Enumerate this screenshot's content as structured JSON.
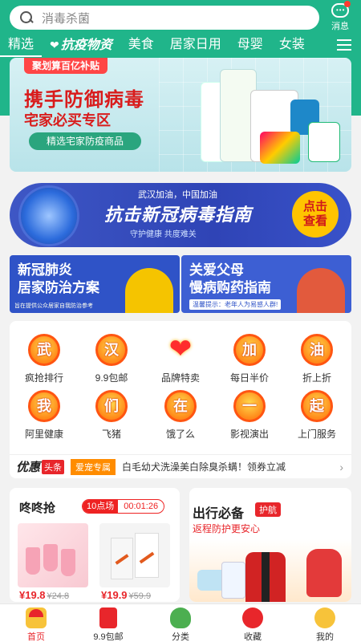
{
  "search": {
    "placeholder": "消毒杀菌"
  },
  "header": {
    "message_label": "消息"
  },
  "tabs": [
    {
      "label": "精选"
    },
    {
      "label": "抗疫物资"
    },
    {
      "label": "美食"
    },
    {
      "label": "居家日用"
    },
    {
      "label": "母婴"
    },
    {
      "label": "女装"
    }
  ],
  "hero": {
    "tag": "聚划算百亿补贴",
    "title": "携手防御病毒",
    "subtitle": "宅家必买专区",
    "button": "精选宅家防疫商品"
  },
  "guide_banner": {
    "top": "武汉加油，中国加油",
    "title": "抗击新冠病毒指南",
    "subtitle": "守护健康 共度难关",
    "button_line1": "点击",
    "button_line2": "查看"
  },
  "cards": {
    "left_title1": "新冠肺炎",
    "left_title2": "居家防治方案",
    "left_note": "旨在提供公众居家自我防治参考",
    "right_title1": "关爱父母",
    "right_title2": "慢病购药指南",
    "right_note": "温馨提示：老年人为易感人群!"
  },
  "categories": [
    {
      "glyph": "武",
      "label": "疯抢排行"
    },
    {
      "glyph": "汉",
      "label": "9.9包邮"
    },
    {
      "glyph": "❤",
      "label": "品牌特卖"
    },
    {
      "glyph": "加",
      "label": "每日半价"
    },
    {
      "glyph": "油",
      "label": "折上折"
    },
    {
      "glyph": "我",
      "label": "阿里健康"
    },
    {
      "glyph": "们",
      "label": "飞猪"
    },
    {
      "glyph": "在",
      "label": "饿了么"
    },
    {
      "glyph": "一",
      "label": "影视演出"
    },
    {
      "glyph": "起",
      "label": "上门服务"
    }
  ],
  "promo": {
    "logo": "优惠",
    "badge": "头条",
    "tag": "爱宠专属",
    "text": "白毛幼犬洗澡美白除臭杀螨！领券立减",
    "arrow": "›"
  },
  "deal": {
    "title": "咚咚抢",
    "session": "10点场",
    "countdown": "00:01:26",
    "items": [
      {
        "price": "¥19.8",
        "old_price": "¥24.8"
      },
      {
        "price": "¥19.9",
        "old_price": "¥59.9"
      }
    ]
  },
  "travel": {
    "title": "出行必备",
    "tag": "护航",
    "subtitle": "返程防护更安心"
  },
  "nav": [
    {
      "label": "首页"
    },
    {
      "label": "9.9包邮"
    },
    {
      "label": "分类"
    },
    {
      "label": "收藏"
    },
    {
      "label": "我的"
    }
  ],
  "colors": {
    "brand_green": "#20b58a",
    "accent_red": "#e8262b"
  }
}
